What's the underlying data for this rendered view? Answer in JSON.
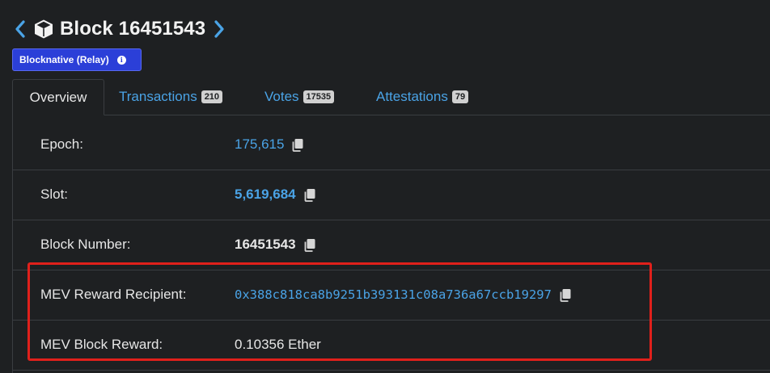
{
  "header": {
    "title": "Block 16451543",
    "prev_icon": "chevron-left-icon",
    "next_icon": "chevron-right-icon",
    "block_icon": "cube-icon"
  },
  "badge": {
    "label": "Blocknative (Relay)",
    "icon": "info-icon",
    "color": "#2b3fd8"
  },
  "tabs": [
    {
      "label": "Overview",
      "active": true
    },
    {
      "label": "Transactions",
      "count": "210"
    },
    {
      "label": "Votes",
      "count": "17535"
    },
    {
      "label": "Attestations",
      "count": "79"
    }
  ],
  "rows": {
    "epoch": {
      "label": "Epoch:",
      "value": "175,615"
    },
    "slot": {
      "label": "Slot:",
      "value": "5,619,684"
    },
    "block_number": {
      "label": "Block Number:",
      "value": "16451543"
    },
    "mev_recipient": {
      "label": "MEV Reward Recipient:",
      "value": "0x388c818ca8b9251b393131c08a736a67ccb19297"
    },
    "mev_reward": {
      "label": "MEV Block Reward:",
      "value": "0.10356 Ether"
    }
  },
  "colors": {
    "accent": "#4aa3e6",
    "highlight": "#e0201b",
    "background": "#1e2022"
  }
}
